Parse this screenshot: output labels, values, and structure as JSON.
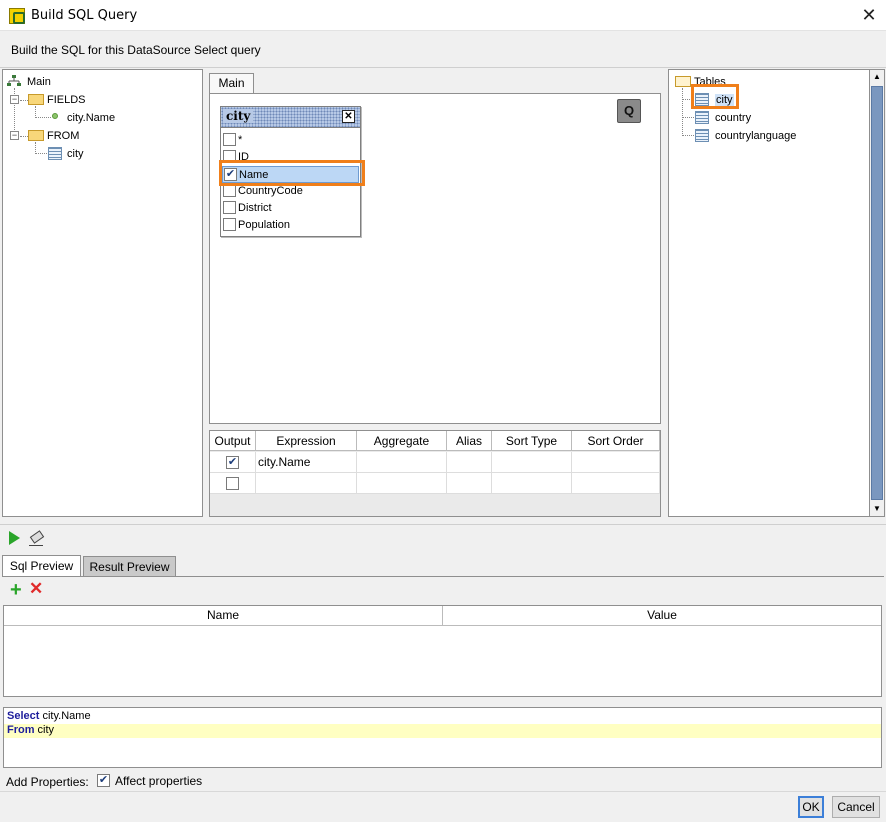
{
  "window": {
    "title": "Build SQL Query",
    "close_symbol": "✕"
  },
  "header": {
    "subtitle": "Build the SQL for this DataSource Select query"
  },
  "tree": {
    "root": "Main",
    "fields_node": "FIELDS",
    "field_item": "city.Name",
    "from_node": "FROM",
    "from_item": "city"
  },
  "designer": {
    "tab_label": "Main",
    "query_button": "Q",
    "table_box": {
      "title": "city",
      "close_symbol": "✕",
      "fields": [
        {
          "label": "*",
          "checked": false
        },
        {
          "label": "ID",
          "checked": false
        },
        {
          "label": "Name",
          "checked": true
        },
        {
          "label": "CountryCode",
          "checked": false
        },
        {
          "label": "District",
          "checked": false
        },
        {
          "label": "Population",
          "checked": false
        }
      ]
    }
  },
  "grid": {
    "columns": [
      "Output",
      "Expression",
      "Aggregate",
      "Alias",
      "Sort Type",
      "Sort Order"
    ],
    "rows": [
      {
        "output": true,
        "expression": "city.Name"
      },
      {
        "output": false,
        "expression": ""
      }
    ]
  },
  "tables": {
    "root": "Tables",
    "items": [
      "city",
      "country",
      "countrylanguage"
    ]
  },
  "bottom": {
    "tabs": [
      "Sql Preview",
      "Result Preview"
    ],
    "props_columns": [
      "Name",
      "Value"
    ],
    "sql": {
      "line1_keyword": "Select",
      "line1_rest": " city.Name",
      "line2_keyword": "From",
      "line2_rest": " city"
    },
    "add_properties_label": "Add Properties:",
    "affect_properties_label": "Affect properties",
    "affect_properties_checked": true
  },
  "buttons": {
    "ok": "OK",
    "cancel": "Cancel"
  },
  "colors": {
    "highlight": "#f07f1a",
    "keyword": "#1d1d9c",
    "sql_highlight_line": "#ffffc2"
  },
  "icons": [
    "app-icon",
    "tree-icon",
    "folder-icon",
    "table-icon",
    "run-icon",
    "eraser-icon",
    "plus-icon",
    "delete-icon"
  ]
}
